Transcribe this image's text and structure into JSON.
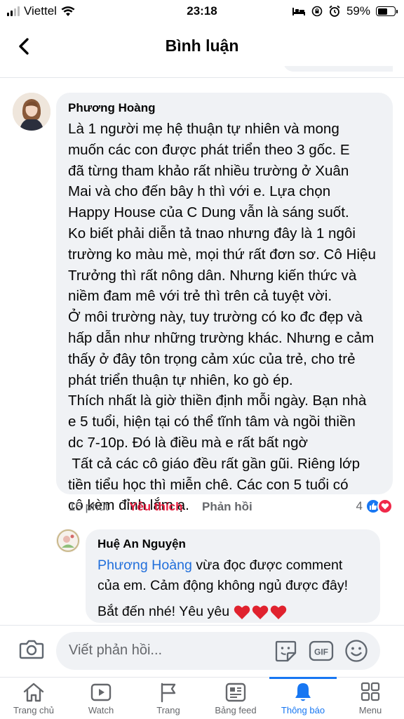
{
  "status_bar": {
    "carrier": "Viettel",
    "time": "23:18",
    "battery": "59%",
    "battery_level": 0.59,
    "icons": [
      "signal-icon",
      "wifi-icon",
      "bed-icon",
      "screen-lock-icon",
      "alarm-icon",
      "battery-icon"
    ]
  },
  "header": {
    "title": "Bình luận",
    "back_icon": "chevron-left-icon"
  },
  "comment": {
    "author": "Phương Hoàng",
    "lines": [
      "Là 1 người mẹ hệ thuận tự nhiên và mong",
      "muốn các con được phát triển theo 3 gốc. E",
      "đã từng tham khảo rất nhiều trường ở Xuân",
      "Mai và cho đến bây h thì với e. Lựa chọn",
      "Happy House của C Dung vẫn là sáng suốt.",
      "Ko biết phải diễn tả tnao nhưng đây là 1 ngôi",
      "trường ko màu mè, mọi thứ rất đơn sơ. Cô Hiệu",
      "Trưởng thì rất nông dân. Nhưng kiến thức và",
      "niềm đam mê với trẻ thì trên cả tuyệt vời.",
      "Ở môi trường này, tuy trường có ko đc đẹp và",
      "hấp dẫn như những trường khác. Nhưng e cảm",
      "thấy ở đây tôn trọng cảm xúc của trẻ, cho trẻ",
      "phát triển thuận tự nhiên, ko gò ép.",
      "Thích nhất là giờ thiền định mỗi ngày. Bạn nhà",
      "e 5 tuổi, hiện tại có thể tĩnh tâm và ngồi thiền",
      "dc 7-10p. Đó là điều mà e rất bất ngờ",
      " Tất cả các cô giáo đều rất gần gũi. Riêng lớp",
      "tiền tiểu học thì miễn chê. Các con 5 tuổi có",
      "cô kèm đỉnh lắm ạ."
    ],
    "time": "15 phút",
    "like_label": "Yêu thích",
    "reply_label": "Phản hồi",
    "reaction_count": "4",
    "reactions": [
      "like-icon",
      "love-icon"
    ]
  },
  "reply": {
    "author": "Huệ An Nguyện",
    "mention": "Phương Hoàng",
    "text_line1_rest": " vừa đọc được comment",
    "text_line2": "của em. Cảm động không ngủ được đây!",
    "text_line3": "Bắt đến nhé! Yêu yêu",
    "emoji": [
      "heart-icon",
      "heart-icon",
      "heart-icon"
    ]
  },
  "composer": {
    "placeholder": "Viết phản hồi...",
    "icons": [
      "camera-icon",
      "sticker-icon",
      "gif-icon",
      "emoji-icon"
    ],
    "gif_label": "GIF"
  },
  "tabs": [
    {
      "label": "Trang chủ",
      "icon": "home-icon",
      "active": false
    },
    {
      "label": "Watch",
      "icon": "watch-icon",
      "active": false
    },
    {
      "label": "Trang",
      "icon": "flag-icon",
      "active": false
    },
    {
      "label": "Bảng feed",
      "icon": "feed-icon",
      "active": false
    },
    {
      "label": "Thông báo",
      "icon": "bell-icon",
      "active": true
    },
    {
      "label": "Menu",
      "icon": "menu-grid-icon",
      "active": false
    }
  ],
  "colors": {
    "accent": "#1877f2",
    "like_red": "#e41e3f",
    "bubble": "#f0f2f5",
    "mention": "#216fdb"
  }
}
